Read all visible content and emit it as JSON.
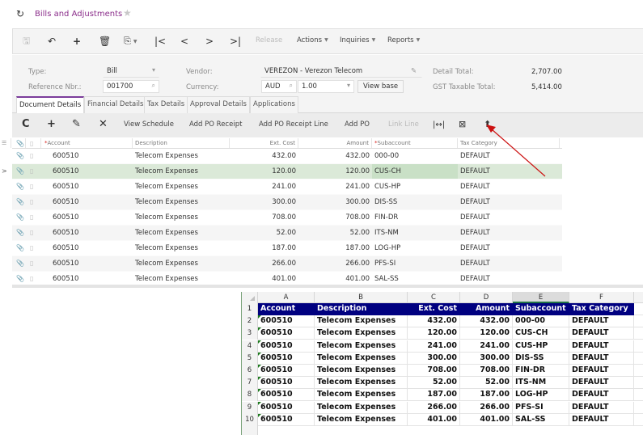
{
  "header": {
    "title": "Bills and Adjustments",
    "refresh_icon": "refresh-icon",
    "favorite_icon": "star-icon"
  },
  "toolbar": {
    "release_label": "Release",
    "actions_label": "Actions",
    "inquiries_label": "Inquiries",
    "reports_label": "Reports"
  },
  "form": {
    "type_label": "Type:",
    "type_value": "Bill",
    "ref_label": "Reference Nbr.:",
    "ref_value": "001700",
    "vendor_label": "Vendor:",
    "vendor_value": "VEREZON - Verezon Telecom",
    "currency_label": "Currency:",
    "currency_value": "AUD",
    "rate_value": "1.00",
    "view_base_label": "View base",
    "detail_total_label": "Detail Total:",
    "detail_total_value": "2,707.00",
    "gst_label": "GST Taxable Total:",
    "gst_value": "5,414.00"
  },
  "tabs": [
    {
      "label": "Document Details",
      "active": true
    },
    {
      "label": "Financial Details",
      "active": false
    },
    {
      "label": "Tax Details",
      "active": false
    },
    {
      "label": "Approval Details",
      "active": false
    },
    {
      "label": "Applications",
      "active": false
    }
  ],
  "grid_toolbar": {
    "view_schedule": "View Schedule",
    "add_po_receipt": "Add PO Receipt",
    "add_po_receipt_line": "Add PO Receipt Line",
    "add_po": "Add PO",
    "link_line": "Link Line"
  },
  "grid": {
    "columns": {
      "account": "Account",
      "description": "Description",
      "ext_cost": "Ext. Cost",
      "amount": "Amount",
      "subaccount": "Subaccount",
      "tax_category": "Tax Category"
    },
    "rows": [
      {
        "account": "600510",
        "description": "Telecom Expenses",
        "ext_cost": "432.00",
        "amount": "432.00",
        "subaccount": "000-00",
        "tax_category": "DEFAULT"
      },
      {
        "account": "600510",
        "description": "Telecom Expenses",
        "ext_cost": "120.00",
        "amount": "120.00",
        "subaccount": "CUS-CH",
        "tax_category": "DEFAULT"
      },
      {
        "account": "600510",
        "description": "Telecom Expenses",
        "ext_cost": "241.00",
        "amount": "241.00",
        "subaccount": "CUS-HP",
        "tax_category": "DEFAULT"
      },
      {
        "account": "600510",
        "description": "Telecom Expenses",
        "ext_cost": "300.00",
        "amount": "300.00",
        "subaccount": "DIS-SS",
        "tax_category": "DEFAULT"
      },
      {
        "account": "600510",
        "description": "Telecom Expenses",
        "ext_cost": "708.00",
        "amount": "708.00",
        "subaccount": "FIN-DR",
        "tax_category": "DEFAULT"
      },
      {
        "account": "600510",
        "description": "Telecom Expenses",
        "ext_cost": "52.00",
        "amount": "52.00",
        "subaccount": "ITS-NM",
        "tax_category": "DEFAULT"
      },
      {
        "account": "600510",
        "description": "Telecom Expenses",
        "ext_cost": "187.00",
        "amount": "187.00",
        "subaccount": "LOG-HP",
        "tax_category": "DEFAULT"
      },
      {
        "account": "600510",
        "description": "Telecom Expenses",
        "ext_cost": "266.00",
        "amount": "266.00",
        "subaccount": "PFS-SI",
        "tax_category": "DEFAULT"
      },
      {
        "account": "600510",
        "description": "Telecom Expenses",
        "ext_cost": "401.00",
        "amount": "401.00",
        "subaccount": "SAL-SS",
        "tax_category": "DEFAULT"
      }
    ],
    "selected_row": 1
  },
  "excel": {
    "col_letters": [
      "A",
      "B",
      "C",
      "D",
      "E",
      "F"
    ],
    "selected_col": "E",
    "header": [
      "Account",
      "Description",
      "Ext. Cost",
      "Amount",
      "Subaccount",
      "Tax Category"
    ],
    "rows": [
      [
        "600510",
        "Telecom Expenses",
        "432.00",
        "432.00",
        "000-00",
        "DEFAULT"
      ],
      [
        "600510",
        "Telecom Expenses",
        "120.00",
        "120.00",
        "CUS-CH",
        "DEFAULT"
      ],
      [
        "600510",
        "Telecom Expenses",
        "241.00",
        "241.00",
        "CUS-HP",
        "DEFAULT"
      ],
      [
        "600510",
        "Telecom Expenses",
        "300.00",
        "300.00",
        "DIS-SS",
        "DEFAULT"
      ],
      [
        "600510",
        "Telecom Expenses",
        "708.00",
        "708.00",
        "FIN-DR",
        "DEFAULT"
      ],
      [
        "600510",
        "Telecom Expenses",
        "52.00",
        "52.00",
        "ITS-NM",
        "DEFAULT"
      ],
      [
        "600510",
        "Telecom Expenses",
        "187.00",
        "187.00",
        "LOG-HP",
        "DEFAULT"
      ],
      [
        "600510",
        "Telecom Expenses",
        "266.00",
        "266.00",
        "PFS-SI",
        "DEFAULT"
      ],
      [
        "600510",
        "Telecom Expenses",
        "401.00",
        "401.00",
        "SAL-SS",
        "DEFAULT"
      ]
    ],
    "header_color": "#000080"
  },
  "colors": {
    "accent": "#7b3c9a",
    "title": "#8a2d8a",
    "selected_row": "#dbe9d8",
    "annotation_arrow": "#cc1111"
  }
}
